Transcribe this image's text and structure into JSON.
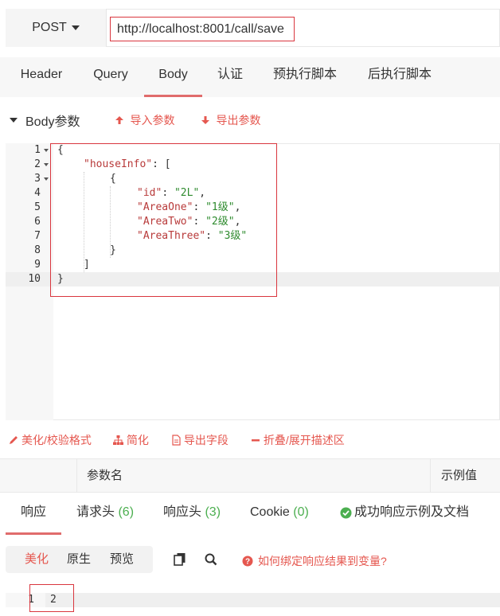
{
  "request": {
    "method": "POST",
    "url": "http://localhost:8001/call/save"
  },
  "tabs": [
    "Header",
    "Query",
    "Body",
    "认证",
    "预执行脚本",
    "后执行脚本"
  ],
  "body_section": {
    "title": "Body参数",
    "import_label": "导入参数",
    "export_label": "导出参数"
  },
  "editor": {
    "line_numbers": [
      "1",
      "2",
      "3",
      "4",
      "5",
      "6",
      "7",
      "8",
      "9",
      "10"
    ],
    "lines": {
      "l1": "{",
      "l2_key": "\"houseInfo\"",
      "l2_rest": ": [",
      "l3": "{",
      "l4_key": "\"id\"",
      "l4_sep": ": ",
      "l4_val": "\"2L\"",
      "l4_end": ",",
      "l5_key": "\"AreaOne\"",
      "l5_sep": ": ",
      "l5_val": "\"1级\"",
      "l5_end": ",",
      "l6_key": "\"AreaTwo\"",
      "l6_sep": ": ",
      "l6_val": "\"2级\"",
      "l6_end": ",",
      "l7_key": "\"AreaThree\"",
      "l7_sep": ": ",
      "l7_val": "\"3级\"",
      "l8": "}",
      "l9": "]",
      "l10": "}"
    }
  },
  "tools": {
    "beautify": "美化/校验格式",
    "simplify": "简化",
    "export_fields": "导出字段",
    "fold": "折叠/展开描述区"
  },
  "param_table": {
    "col_name": "参数名",
    "col_example": "示例值"
  },
  "response_tabs": {
    "response": "响应",
    "req_headers": "请求头",
    "req_headers_count": "(6)",
    "resp_headers": "响应头",
    "resp_headers_count": "(3)",
    "cookie": "Cookie",
    "cookie_count": "(0)",
    "success_example": "成功响应示例及文档"
  },
  "response_toolbar": {
    "beautify": "美化",
    "raw": "原生",
    "preview": "预览",
    "help": "如何绑定响应结果到变量?"
  },
  "response_body": {
    "line_number": "1",
    "value": "2"
  },
  "colors": {
    "accent": "#e5574f",
    "green": "#4caf50"
  }
}
